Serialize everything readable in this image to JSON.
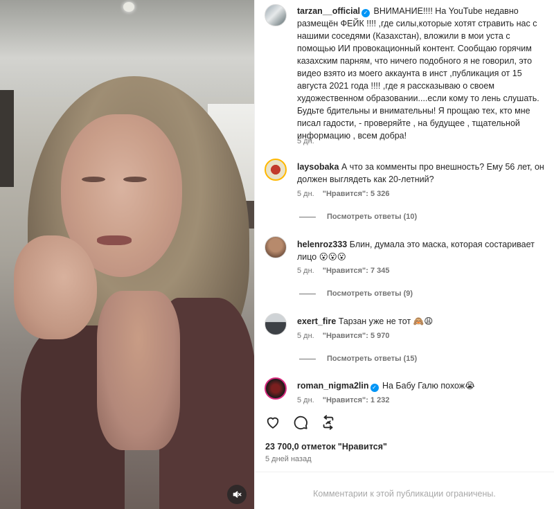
{
  "post": {
    "author": "tarzan__official",
    "caption": "ВНИМАНИЕ!!!! На YouTube недавно размещён ФЕЙК !!!! ,где силы,которые хотят стравить нас с нашими соседями (Казахстан), вложили в мои уста с помощью ИИ провокационный контент. Сообщаю горячим казахским парням, что ничего подобного я не говорил, это видео взято из моего аккаунта в инст ,публикация от 15 августа 2021 года !!!! ,где я рассказываю о своем художественном образовании....если кому то лень слушать. Будьте бдительны и внимательны! Я прощаю тех, кто мне писал гадости, - проверяйте , на будущее , тщательной информацию , всем добра!",
    "time": "5 дн."
  },
  "comments": [
    {
      "user": "laysobaka",
      "text": "А что за комменты про внешность? Ему 56 лет, он должен выглядеть как 20-летний?",
      "time": "5 дн.",
      "likes": "\"Нравится\": 5 326",
      "replies": "Посмотреть ответы (10)"
    },
    {
      "user": "helenroz333",
      "text": "Блин, думала это маска, которая состаривает лицо 😮😮😮",
      "time": "5 дн.",
      "likes": "\"Нравится\": 7 345",
      "replies": "Посмотреть ответы (9)"
    },
    {
      "user": "exert_fire",
      "text": "Тарзан уже не тот 🙈😩",
      "time": "5 дн.",
      "likes": "\"Нравится\": 5 970",
      "replies": "Посмотреть ответы (15)"
    },
    {
      "user": "roman_nigma2lin",
      "text": "На Бабу Галю похож😭",
      "time": "5 дн.",
      "likes": "\"Нравится\": 1 232"
    }
  ],
  "stats": {
    "likes": "23 700,0 отметок \"Нравится\"",
    "posted": "5 дней назад"
  },
  "footer": {
    "limited": "Комментарии к этой публикации ограничены."
  },
  "icons": {
    "like": "heart-icon",
    "comment": "comment-icon",
    "repost": "repost-icon",
    "mute": "speaker-muted-icon",
    "verified": "verified-badge-icon"
  },
  "colors": {
    "verified": "#0095f6",
    "text": "#262626",
    "secondary": "#737373"
  }
}
